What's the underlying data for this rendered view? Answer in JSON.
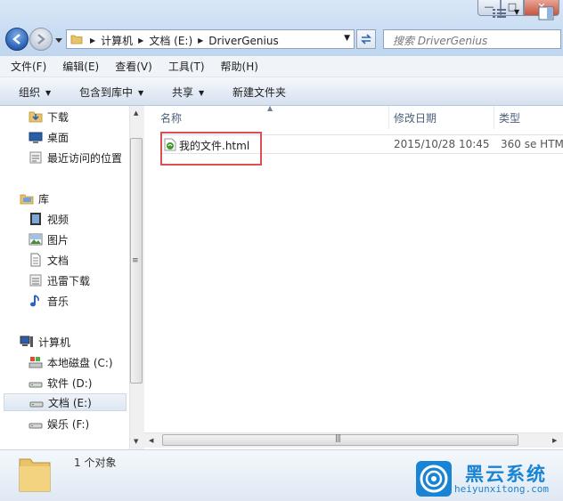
{
  "window": {
    "controls": {
      "minimize": "—",
      "maximize": "□",
      "close": "✕"
    }
  },
  "address": {
    "crumbs": [
      "计算机",
      "文档 (E:)",
      "DriverGenius"
    ]
  },
  "search": {
    "placeholder": "搜索 DriverGenius"
  },
  "menu": {
    "items": [
      "文件(F)",
      "编辑(E)",
      "查看(V)",
      "工具(T)",
      "帮助(H)"
    ]
  },
  "toolbar": {
    "organize": "组织",
    "include_in_library": "包含到库中",
    "share": "共享",
    "new_folder": "新建文件夹"
  },
  "nav": {
    "favorites": [
      "下载",
      "桌面",
      "最近访问的位置"
    ],
    "library_header": "库",
    "libraries": [
      "视频",
      "图片",
      "文档",
      "迅雷下载",
      "音乐"
    ],
    "computer_header": "计算机",
    "drives": [
      "本地磁盘 (C:)",
      "软件 (D:)",
      "文档 (E:)",
      "娱乐 (F:)"
    ]
  },
  "columns": {
    "name": "名称",
    "modified": "修改日期",
    "type": "类型"
  },
  "files": [
    {
      "name": "我的文件.html",
      "modified": "2015/10/28 10:45",
      "type": "360 se HTM"
    }
  ],
  "details": {
    "count": "1 个对象"
  },
  "watermark": {
    "title": "黑云系统",
    "url": "heiyunxitong.com"
  },
  "colors": {
    "accent": "#1a84d4",
    "highlight": "#e04f4f"
  }
}
